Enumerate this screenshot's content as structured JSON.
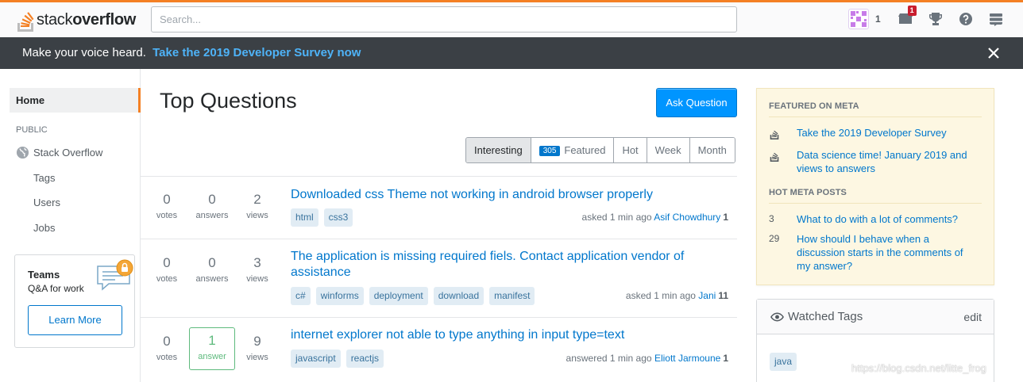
{
  "header": {
    "logo_text_light": "stack",
    "logo_text_bold": "overflow",
    "search_placeholder": "Search...",
    "reputation": "1",
    "inbox_count": "1",
    "accent_color": "#f48024"
  },
  "notice": {
    "message": "Make your voice heard.",
    "link": "Take the 2019 Developer Survey now"
  },
  "sidebar": {
    "home": "Home",
    "public_label": "PUBLIC",
    "stack_overflow": "Stack Overflow",
    "tags": "Tags",
    "users": "Users",
    "jobs": "Jobs",
    "teams": {
      "title": "Teams",
      "subtitle": "Q&A for work",
      "button": "Learn More"
    }
  },
  "main": {
    "title": "Top Questions",
    "ask_button": "Ask Question",
    "filters": [
      {
        "label": "Interesting",
        "active": true
      },
      {
        "label": "Featured",
        "count": "305"
      },
      {
        "label": "Hot"
      },
      {
        "label": "Week"
      },
      {
        "label": "Month"
      }
    ],
    "questions": [
      {
        "votes": "0",
        "votes_label": "votes",
        "answers": "0",
        "answers_label": "answers",
        "views": "2",
        "views_label": "views",
        "title": "Downloaded css Theme not working in android browser properly",
        "tags": [
          "html",
          "css3"
        ],
        "action": "asked 1 min ago",
        "user": "Asif Chowdhury",
        "user_rep": "1"
      },
      {
        "votes": "0",
        "votes_label": "votes",
        "answers": "0",
        "answers_label": "answers",
        "views": "3",
        "views_label": "views",
        "title": "The application is missing required fiels. Contact application vendor of assistance",
        "tags": [
          "c#",
          "winforms",
          "deployment",
          "download",
          "manifest"
        ],
        "action": "asked 1 min ago",
        "user": "Jani",
        "user_rep": "11"
      },
      {
        "votes": "0",
        "votes_label": "votes",
        "answers": "1",
        "answers_label": "answer",
        "views": "9",
        "views_label": "views",
        "title": "internet explorer not able to type anything in input type=text",
        "tags": [
          "javascript",
          "reactjs"
        ],
        "action": "answered 1 min ago",
        "user": "Eliott Jarmoune",
        "user_rep": "1"
      }
    ]
  },
  "right": {
    "featured_heading": "FEATURED ON META",
    "featured": [
      "Take the 2019 Developer Survey",
      "Data science time! January 2019 and views to answers"
    ],
    "hot_heading": "HOT META POSTS",
    "hot": [
      {
        "count": "3",
        "title": "What to do with a lot of comments?"
      },
      {
        "count": "29",
        "title": "How should I behave when a discussion starts in the comments of my answer?"
      }
    ],
    "watched_title": "Watched Tags",
    "watched_edit": "edit",
    "watched_tags": [
      "java"
    ]
  },
  "watermark": "https://blog.csdn.net/litte_frog"
}
